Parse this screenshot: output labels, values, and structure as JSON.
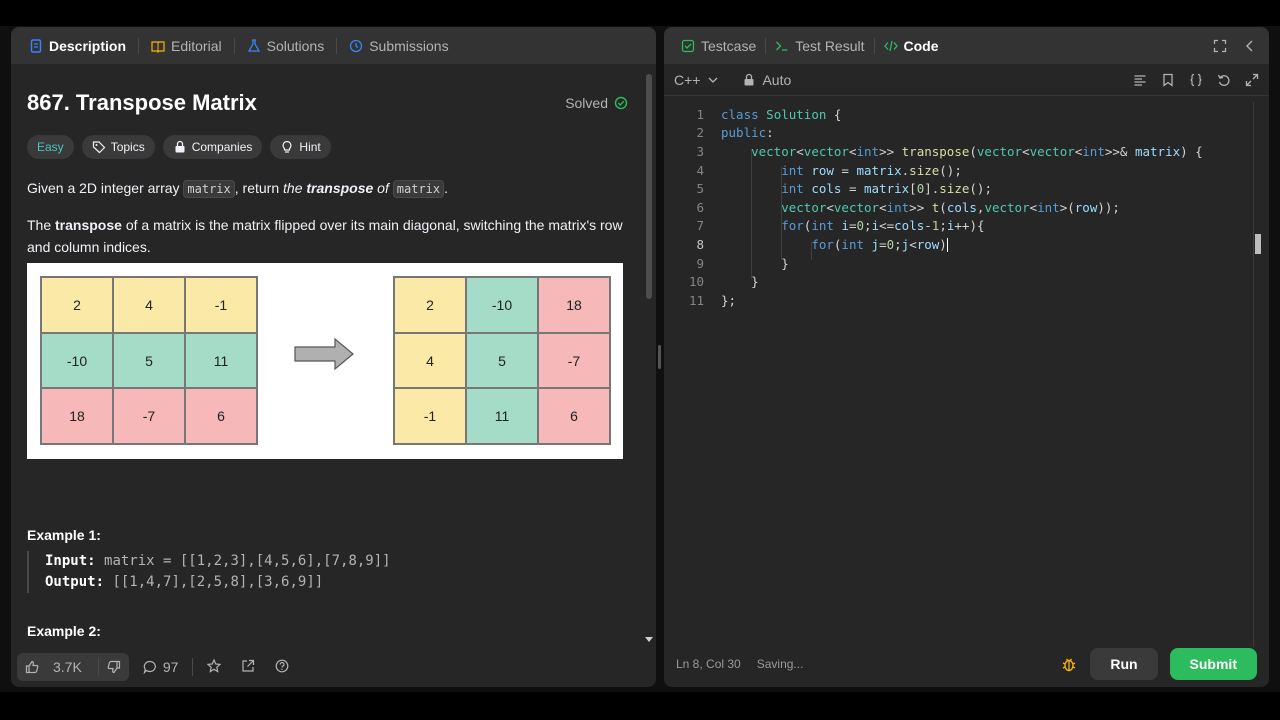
{
  "left_tabs": [
    {
      "label": "Description",
      "icon": "document-icon",
      "active": true
    },
    {
      "label": "Editorial",
      "icon": "book-icon",
      "active": false
    },
    {
      "label": "Solutions",
      "icon": "flask-icon",
      "active": false
    },
    {
      "label": "Submissions",
      "icon": "history-icon",
      "active": false
    }
  ],
  "problem": {
    "title": "867. Transpose Matrix",
    "status": "Solved",
    "difficulty": "Easy",
    "topics": "Topics",
    "companies": "Companies",
    "hint": "Hint",
    "p1_a": "Given a 2D integer array ",
    "p1_code": "matrix",
    "p1_b": ", return ",
    "p1_c": "the ",
    "p1_d": "transpose",
    "p1_e": " of ",
    "p1_code2": "matrix",
    "p1_f": ".",
    "p2_a": "The ",
    "p2_b": "transpose",
    "p2_c": " of a matrix is the matrix flipped over its main diagonal, switching the matrix's row and column indices."
  },
  "figure": {
    "left_matrix": [
      [
        "2",
        "4",
        "-1"
      ],
      [
        "-10",
        "5",
        "11"
      ],
      [
        "18",
        "-7",
        "6"
      ]
    ],
    "right_matrix": [
      [
        "2",
        "-10",
        "18"
      ],
      [
        "4",
        "5",
        "-7"
      ],
      [
        "-1",
        "11",
        "6"
      ]
    ]
  },
  "examples": {
    "ex1_title": "Example 1:",
    "ex1_input_label": "Input:",
    "ex1_input": "matrix = [[1,2,3],[4,5,6],[7,8,9]]",
    "ex1_output_label": "Output:",
    "ex1_output": "[[1,4,7],[2,5,8],[3,6,9]]",
    "ex2_title": "Example 2:"
  },
  "left_footer": {
    "likes": "3.7K",
    "comments": "97"
  },
  "right_tabs": [
    {
      "label": "Testcase",
      "icon": "checkbox-icon",
      "active": false
    },
    {
      "label": "Test Result",
      "icon": "terminal-icon",
      "active": false
    },
    {
      "label": "Code",
      "icon": "code-icon",
      "active": true
    }
  ],
  "editor": {
    "language": "C++",
    "mode": "Auto",
    "lines": [
      {
        "n": "1"
      },
      {
        "n": "2"
      },
      {
        "n": "3"
      },
      {
        "n": "4"
      },
      {
        "n": "5"
      },
      {
        "n": "6"
      },
      {
        "n": "7"
      },
      {
        "n": "8"
      },
      {
        "n": "9"
      },
      {
        "n": "10"
      },
      {
        "n": "11"
      }
    ],
    "status_pos": "Ln 8, Col 30",
    "status_save": "Saving...",
    "run": "Run",
    "submit": "Submit"
  },
  "colors": {
    "accent_green": "#2cbb5d",
    "easy": "#46c6c2",
    "cell_yellow": "#fbe9a7",
    "cell_green": "#a4dcc7",
    "cell_red": "#f6b8b8"
  }
}
